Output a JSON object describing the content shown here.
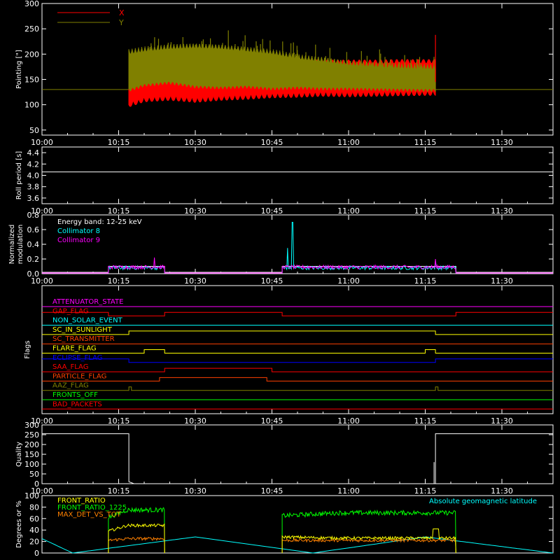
{
  "colors": {
    "background": "#000000",
    "axes": "#ffffff",
    "x_series": "#ff0000",
    "y_series": "#808000",
    "collimator_8": "#00ffff",
    "collimator_9": "#ff00ff",
    "geomag": "#00ffff",
    "front_ratio": "#ffff00",
    "front_ratio_1225": "#00ff00",
    "max_det": "#ff8000"
  },
  "chart_data": [
    {
      "id": "pointing",
      "type": "line",
      "ylabel": "Pointing [\"]",
      "xlim": [
        "10:00",
        "11:40"
      ],
      "ylim": [
        40,
        300
      ],
      "yticks": [
        "50",
        "100",
        "150",
        "200",
        "250",
        "300"
      ],
      "xticks": [
        "10:00",
        "10:15",
        "10:30",
        "10:45",
        "11:00",
        "11:15",
        "11:30"
      ],
      "legend_position": "top-left",
      "legend": [
        {
          "name": "X",
          "color": "#ff0000"
        },
        {
          "name": "Y",
          "color": "#808000"
        }
      ],
      "baseline_value": 130,
      "series": [
        {
          "name": "X",
          "x": [
            "10:17",
            "10:20",
            "10:25",
            "10:30",
            "10:35",
            "10:40",
            "10:45",
            "10:50",
            "10:55",
            "11:00",
            "11:05",
            "11:10",
            "11:17"
          ],
          "upper": [
            170,
            185,
            185,
            185,
            186,
            185,
            186,
            186,
            185,
            185,
            185,
            186,
            186
          ],
          "lower": [
            105,
            115,
            118,
            114,
            118,
            120,
            123,
            124,
            126,
            125,
            126,
            127,
            128
          ]
        },
        {
          "name": "Y",
          "x": [
            "10:17",
            "10:20",
            "10:25",
            "10:30",
            "10:35",
            "10:40",
            "10:45",
            "10:50",
            "10:55",
            "11:00",
            "11:05",
            "11:10",
            "11:17"
          ],
          "upper": [
            210,
            215,
            220,
            222,
            220,
            215,
            210,
            200,
            195,
            188,
            185,
            182,
            180
          ],
          "lower": [
            125,
            135,
            140,
            132,
            130,
            132,
            128,
            130,
            128,
            128,
            127,
            126,
            125
          ]
        }
      ]
    },
    {
      "id": "roll",
      "type": "line",
      "ylabel": "Roll period [s]",
      "xlim": [
        "10:00",
        "11:40"
      ],
      "ylim": [
        3.5,
        4.5
      ],
      "yticks": [
        "3.6",
        "3.8",
        "4.0",
        "4.2",
        "4.4"
      ],
      "xticks": [
        "10:00",
        "10:15",
        "10:30",
        "10:45",
        "11:00",
        "11:15",
        "11:30"
      ],
      "series": [
        {
          "x": [
            "10:00",
            "11:40"
          ],
          "y": [
            4.06,
            4.06
          ]
        }
      ]
    },
    {
      "id": "modulation",
      "type": "line",
      "ylabel": [
        "Normalized",
        "modulation"
      ],
      "xlim": [
        "10:00",
        "11:40"
      ],
      "ylim": [
        0,
        0.8
      ],
      "yticks": [
        "0.0",
        "0.2",
        "0.4",
        "0.6",
        "0.8"
      ],
      "xticks": [
        "10:00",
        "10:15",
        "10:30",
        "10:45",
        "11:00",
        "11:15",
        "11:30"
      ],
      "annotation": "Energy band: 12-25 keV",
      "legend_position": "top-left",
      "legend": [
        {
          "name": "Collimator 8",
          "color": "#00ffff"
        },
        {
          "name": "Collimator 9",
          "color": "#ff00ff"
        }
      ],
      "intervals": [
        [
          "10:13",
          "10:24"
        ],
        [
          "10:47",
          "11:21"
        ]
      ],
      "series": [
        {
          "name": "Collimator 8",
          "level": 0.08,
          "spikes": [
            [
              "10:48",
              0.35
            ],
            [
              "10:49",
              0.7
            ],
            [
              "11:17",
              0.18
            ]
          ]
        },
        {
          "name": "Collimator 9",
          "level": 0.09,
          "spikes": [
            [
              "10:22",
              0.22
            ],
            [
              "11:17",
              0.2
            ]
          ]
        }
      ]
    },
    {
      "id": "flags",
      "type": "line",
      "ylabel": "Flags",
      "xlim": [
        "10:00",
        "11:40"
      ],
      "xticks": [
        "10:00",
        "10:15",
        "10:30",
        "10:45",
        "11:00",
        "11:15",
        "11:30"
      ],
      "flags": [
        {
          "name": "ATTENUATOR_STATE",
          "color": "#ff00ff",
          "steps": [],
          "default": 0
        },
        {
          "name": "GAP_FLAG",
          "color": "#ff0000",
          "steps": [
            [
              "10:13",
              0
            ],
            [
              "10:24",
              1
            ],
            [
              "10:47",
              0
            ],
            [
              "11:21",
              1
            ]
          ],
          "default": 1
        },
        {
          "name": "NON_SOLAR_EVENT",
          "color": "#00ffff",
          "steps": [],
          "default": 0
        },
        {
          "name": "SC_IN_SUNLIGHT",
          "color": "#ffff00",
          "steps": [
            [
              "10:17",
              1
            ],
            [
              "11:17",
              0
            ]
          ],
          "default": 0
        },
        {
          "name": "SC_TRANSMITTER",
          "color": "#ff4000",
          "steps": [],
          "default": 0
        },
        {
          "name": "FLARE_FLAG",
          "color": "#ffff00",
          "steps": [
            [
              "10:20",
              1
            ],
            [
              "10:24",
              0
            ],
            [
              "11:15",
              1
            ],
            [
              "11:17",
              0
            ]
          ],
          "default": 0
        },
        {
          "name": "ECLIPSE_FLAG",
          "color": "#0000ff",
          "steps": [
            [
              "10:17",
              0
            ],
            [
              "11:17",
              1
            ]
          ],
          "default": 1
        },
        {
          "name": "SAA_FLAG",
          "color": "#ff0000",
          "steps": [
            [
              "10:24",
              1
            ],
            [
              "10:45",
              0
            ]
          ],
          "default": 0
        },
        {
          "name": "PARTICLE_FLAG",
          "color": "#ff4000",
          "steps": [
            [
              "10:23",
              1
            ],
            [
              "10:44",
              0
            ]
          ],
          "default": 0
        },
        {
          "name": "AAZ_FLAG",
          "color": "#808000",
          "steps": [
            [
              "10:17",
              1
            ],
            [
              "10:17.5",
              0
            ],
            [
              "11:17",
              1
            ],
            [
              "11:17.5",
              0
            ]
          ],
          "default": 0
        },
        {
          "name": "FRONTS_OFF",
          "color": "#00ff00",
          "steps": [],
          "default": 0
        },
        {
          "name": "BAD_PACKETS",
          "color": "#ff0000",
          "steps": [],
          "default": 0
        }
      ]
    },
    {
      "id": "quality",
      "type": "line",
      "ylabel": "Quality",
      "xlim": [
        "10:00",
        "11:40"
      ],
      "ylim": [
        0,
        300
      ],
      "yticks": [
        "0",
        "50",
        "100",
        "150",
        "200",
        "250",
        "300"
      ],
      "xticks": [
        "10:00",
        "10:15",
        "10:30",
        "10:45",
        "11:00",
        "11:15",
        "11:30"
      ],
      "series": [
        {
          "x": [
            "10:00",
            "10:17",
            "10:17",
            "10:18",
            "11:17",
            "11:17",
            "11:40"
          ],
          "y": [
            255,
            255,
            10,
            0,
            0,
            255,
            255
          ]
        }
      ]
    },
    {
      "id": "ratio",
      "type": "line",
      "ylabel": "Degrees or %",
      "xlim": [
        "10:00",
        "11:40"
      ],
      "ylim": [
        0,
        100
      ],
      "yticks": [
        "0",
        "20",
        "40",
        "60",
        "80",
        "100"
      ],
      "legend_position": "top-left",
      "legend": [
        {
          "name": "FRONT_RATIO",
          "color": "#ffff00"
        },
        {
          "name": "FRONT_RATIO_1225",
          "color": "#00ff00"
        },
        {
          "name": "MAX_DET_VS_TOT",
          "color": "#ff8000"
        }
      ],
      "annotation": "Absolute geomagnetic latitude",
      "intervals": [
        [
          "10:13",
          "10:24"
        ],
        [
          "10:47",
          "11:21"
        ]
      ],
      "series": [
        {
          "name": "FRONT_RATIO",
          "levels": [
            [
              38,
              48
            ],
            [
              28,
              26
            ]
          ]
        },
        {
          "name": "FRONT_RATIO_1225",
          "levels": [
            [
              62,
              75
            ],
            [
              65,
              70
            ]
          ]
        },
        {
          "name": "MAX_DET_VS_TOT",
          "levels": [
            [
              22,
              25
            ],
            [
              22,
              22
            ]
          ]
        },
        {
          "name": "Absolute geomagnetic latitude",
          "x": [
            "10:00",
            "10:06",
            "10:30",
            "10:53",
            "11:15",
            "11:40"
          ],
          "y": [
            25,
            0,
            28,
            0,
            28,
            0
          ]
        }
      ]
    }
  ]
}
